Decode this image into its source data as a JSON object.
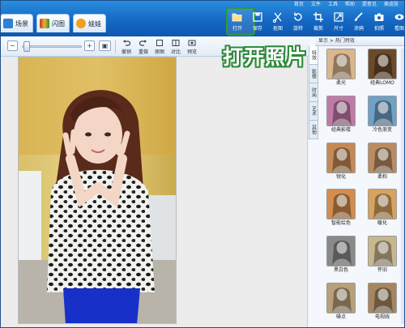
{
  "menu": {
    "items": [
      "首页",
      "文件",
      "工具",
      "帮助",
      "提意见",
      "换皮肤"
    ]
  },
  "tabs": [
    {
      "label": "场景",
      "icon": "scene-icon",
      "color": "#2f7fd2"
    },
    {
      "label": "闪图",
      "icon": "flash-icon",
      "color": "#c3362b"
    },
    {
      "label": "娃娃",
      "icon": "doll-icon",
      "color": "#f0a020"
    }
  ],
  "toolbar": {
    "buttons": [
      {
        "label": "打开",
        "icon": "folder-open-icon"
      },
      {
        "label": "保存",
        "icon": "save-icon"
      },
      {
        "label": "抠图",
        "icon": "cutout-icon"
      },
      {
        "label": "旋转",
        "icon": "rotate-icon"
      },
      {
        "label": "裁剪",
        "icon": "crop-icon"
      },
      {
        "label": "尺寸",
        "icon": "resize-icon"
      },
      {
        "label": "涂鸦",
        "icon": "brush-icon"
      },
      {
        "label": "拍照",
        "icon": "camera-icon"
      },
      {
        "label": "看图",
        "icon": "view-icon"
      }
    ]
  },
  "edit_bar": {
    "zoom_out": "−",
    "zoom_in": "+",
    "zoom_level": 0.05,
    "buttons": [
      "撤销",
      "重做",
      "原图",
      "对比",
      "预览"
    ]
  },
  "panel": {
    "header": "热门特效",
    "header_prefix": "显示",
    "side_tabs": [
      "特效",
      "影楼",
      "时尚",
      "艺术",
      "其他"
    ],
    "effects": [
      {
        "label": "柔光",
        "tint": "#d9b68c"
      },
      {
        "label": "经典LOMO",
        "tint": "#6b4a2a"
      },
      {
        "label": "经典影楼",
        "tint": "#c07aa8"
      },
      {
        "label": "冷色渐变",
        "tint": "#6fa0c6"
      },
      {
        "label": "锐化",
        "tint": "#c48a55"
      },
      {
        "label": "柔和",
        "tint": "#b98c61"
      },
      {
        "label": "智能绘色",
        "tint": "#d28d4f"
      },
      {
        "label": "暖化",
        "tint": "#d7a35e"
      },
      {
        "label": "黑白色",
        "tint": "#8a8a8a"
      },
      {
        "label": "怀旧",
        "tint": "#c8b68e"
      },
      {
        "label": "噪点",
        "tint": "#b8a07a"
      },
      {
        "label": "电视线",
        "tint": "#a68661"
      }
    ]
  },
  "caption": "打开照片",
  "colors": {
    "brand_blue": "#1569c4",
    "highlight_green": "#2e9a3c"
  }
}
